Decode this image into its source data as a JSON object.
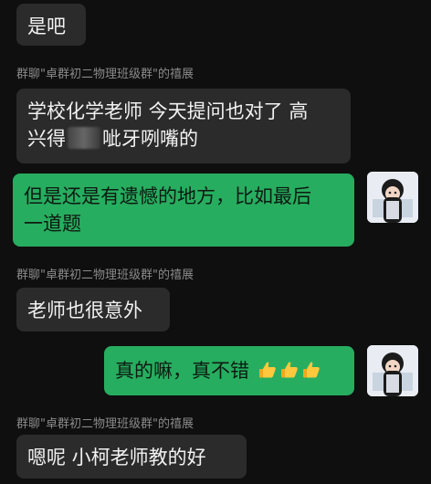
{
  "chat": {
    "messages": [
      {
        "text": "是吧"
      },
      {
        "sender": "群聊\"卓群初二物理班级群\"的禧展",
        "line1": "学校化学老师 今天提问也对了  高",
        "line2_before": "兴得",
        "line2_after": "呲牙咧嘴的"
      },
      {
        "line1": "但是还是有遗憾的地方，比如最后",
        "line2": "一道题"
      },
      {
        "sender": "群聊\"卓群初二物理班级群\"的禧展",
        "text": "老师也很意外"
      },
      {
        "text": "真的嘛，真不错"
      },
      {
        "sender": "群聊\"卓群初二物理班级群\"的禧展",
        "text": "嗯呢  小柯老师教的好"
      }
    ]
  },
  "colors": {
    "background": "#0f0f0f",
    "incoming_bubble": "#2b2b2b",
    "outgoing_bubble": "#27ad5f",
    "sender_text": "#8a8a8a"
  },
  "icons": {
    "avatar": "avatar-anime-girl",
    "emoji": "thumbs-up-emoji"
  }
}
